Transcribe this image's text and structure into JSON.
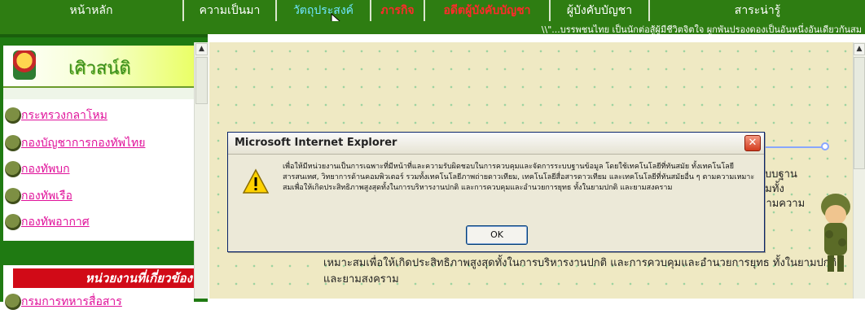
{
  "nav": {
    "items": [
      {
        "label": "หน้าหลัก"
      },
      {
        "label": "ความเป็นมา"
      },
      {
        "label": "วัตถุประสงค์"
      },
      {
        "label": "ภารกิจ"
      },
      {
        "label": "อดีตผู้บังคับบัญชา"
      },
      {
        "label": "ผู้บังคับบัญชา"
      },
      {
        "label": "สาระน่ารู้"
      }
    ]
  },
  "ticker": {
    "text": "\\\\\"...บรรพชนไทย เป็นนักต่อสู้ผู้มีชีวิตจิตใจ ผูกพันปรองดองเป็นอันหนึ่งอันเดียวกันสม"
  },
  "sidebar": {
    "logo_text": "เศิวสน์ติ",
    "links": [
      {
        "label": "กระทรวงกลาโหม"
      },
      {
        "label": "กองบัญชาการกองทัพไทย"
      },
      {
        "label": "กองทัพบก"
      },
      {
        "label": "กองทัพเรือ"
      },
      {
        "label": "กองทัพอากาศ"
      }
    ],
    "section_header": "หน่วยงานที่เกี่ยวข้อง",
    "section_links": [
      {
        "label": "กรมการทหารสื่อสาร"
      }
    ]
  },
  "content": {
    "right_snippet_lines": [
      "ะบบฐาน",
      "วมทั้ง",
      "ตามความ"
    ],
    "paragraph": "เหมาะสมเพื่อให้เกิดประสิทธิภาพสูงสุดทั้งในการบริหารงานปกติ และการควบคุมและอำนวยการยุทธ ทั้งในยามปกติ และยามสงคราม"
  },
  "dialog": {
    "title": "Microsoft Internet Explorer",
    "message": "เพื่อให้มีหน่วยงานเป็นการเฉพาะที่มีหน้าที่และความรับผิดชอบในการควบคุมและจัดการระบบฐานข้อมูล โดยใช้เทคโนโลยีที่ทันสมัย ทั้งเทคโนโลยีสารสนเทศ, วิทยาการด้านคอมพิวเตอร์ รวมทั้งเทคโนโลยีภาพถ่ายดาวเทียม, เทคโนโลยีสื่อสารดาวเทียม และเทคโนโลยีที่ทันสมัยอื่น ๆ ตามความเหมาะสมเพื่อให้เกิดประสิทธิภาพสูงสุดทั้งในการบริหารงานปกติ และการควบคุมและอำนวยการยุทธ ทั้งในยามปกติ และยามสงคราม",
    "ok_label": "OK",
    "close_glyph": "✕"
  },
  "scroll": {
    "up_glyph": "▲",
    "down_glyph": "▼"
  },
  "colors": {
    "nav_bg": "#2e7d12",
    "link_pink": "#e0119a",
    "header_red": "#d10a17",
    "dialog_bg": "#ece9d8"
  },
  "icons": {
    "warning": "warning-icon",
    "soldier": "soldier-bullet-icon",
    "cursor": "mouse-pointer-icon",
    "emblem": "royal-emblem-icon"
  }
}
